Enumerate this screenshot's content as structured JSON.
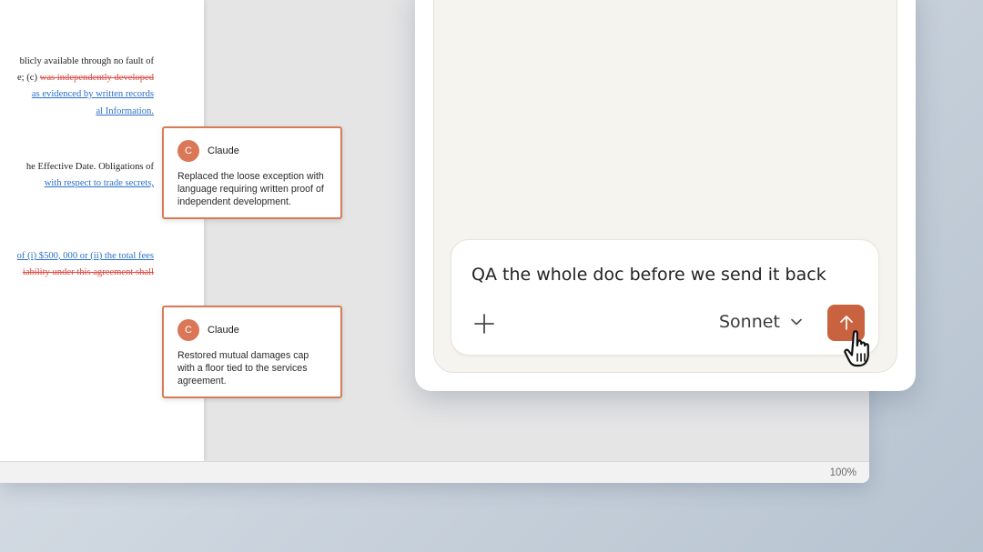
{
  "document": {
    "lines": [
      [
        {
          "t": "blicly available through no fault of",
          "s": "n"
        }
      ],
      [
        {
          "t": "e; (c) ",
          "s": "n"
        },
        {
          "t": "was independently developed",
          "s": "d"
        }
      ],
      [
        {
          "t": "as evidenced by written records",
          "s": "i"
        }
      ],
      [
        {
          "t": "al Information.",
          "s": "i"
        }
      ],
      [
        {
          "t": "he Effective Date. Obligations of",
          "s": "n"
        }
      ],
      [
        {
          "t": "with respect to trade secrets,",
          "s": "i"
        }
      ],
      [
        {
          "t": "of (i) $500, 000 or (ii) the total fees",
          "s": "i"
        }
      ],
      [
        {
          "t": "iability under this agreement shall",
          "s": "d"
        }
      ]
    ]
  },
  "comments": [
    {
      "initial": "C",
      "author": "Claude",
      "text": "Replaced the loose exception with language requiring written proof of independent development."
    },
    {
      "initial": "C",
      "author": "Claude",
      "text": "Restored mutual damages cap with a floor tied to the services agreement."
    }
  ],
  "status_bar": {
    "zoom": "100%"
  },
  "composer": {
    "prompt": "QA the whole doc before we send it back",
    "model": "Sonnet",
    "attach_icon": "plus-icon",
    "send_icon": "arrow-up-icon"
  },
  "colors": {
    "accent": "#c9623f",
    "comment_border": "#d67b56",
    "insertion": "#2a6fc7",
    "deletion": "#d94b45"
  }
}
